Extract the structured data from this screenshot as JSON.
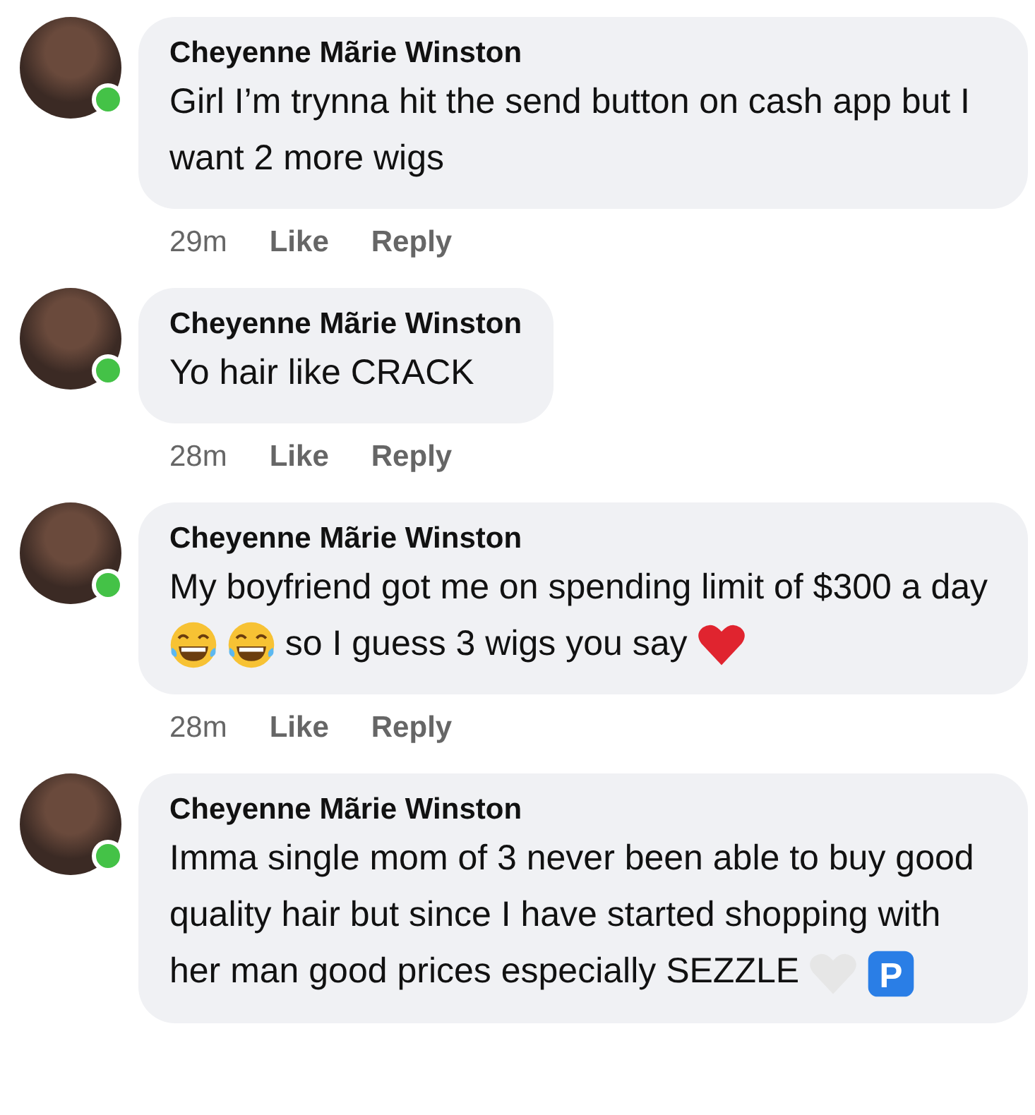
{
  "comments": [
    {
      "author": "Cheyenne Mãrie Winston",
      "online": true,
      "body": [
        {
          "kind": "text",
          "text": "Girl I’m trynna hit the send button on cash app but I want 2 more wigs"
        }
      ],
      "time": "29m",
      "actions": [
        "Like",
        "Reply"
      ]
    },
    {
      "author": "Cheyenne Mãrie Winston",
      "online": true,
      "body": [
        {
          "kind": "text",
          "text": "Yo hair like CRACK"
        }
      ],
      "time": "28m",
      "actions": [
        "Like",
        "Reply"
      ]
    },
    {
      "author": "Cheyenne Mãrie Winston",
      "online": true,
      "body": [
        {
          "kind": "text",
          "text": "My boyfriend got me on spending limit of $300 a day"
        },
        {
          "kind": "laugh"
        },
        {
          "kind": "laugh"
        },
        {
          "kind": "text",
          "text": "so I guess 3 wigs you say"
        },
        {
          "kind": "heart",
          "color": "#e0242f"
        }
      ],
      "time": "28m",
      "actions": [
        "Like",
        "Reply"
      ]
    },
    {
      "author": "Cheyenne Mãrie Winston",
      "online": true,
      "body": [
        {
          "kind": "text",
          "text": "Imma single mom of 3 never been able to buy good quality hair but since I have started shopping with her man good prices especially SEZZLE"
        },
        {
          "kind": "heart",
          "color": "#e6e6e6"
        },
        {
          "kind": "sign",
          "text": "P"
        }
      ]
    }
  ]
}
